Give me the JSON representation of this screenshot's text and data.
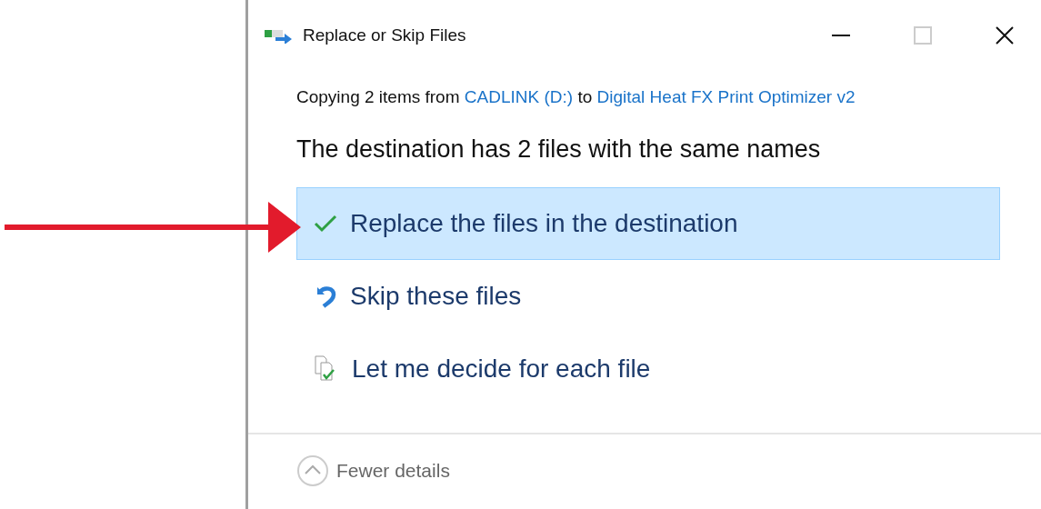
{
  "window": {
    "title": "Replace or Skip Files"
  },
  "copying": {
    "prefix": "Copying 2 items from",
    "source": "CADLINK (D:)",
    "joiner": "to",
    "destination": "Digital Heat FX Print Optimizer v2"
  },
  "heading": "The destination has 2 files with the same names",
  "options": [
    {
      "kind": "replace",
      "label": "Replace the files in the destination",
      "selected": true
    },
    {
      "kind": "skip",
      "label": "Skip these files",
      "selected": false
    },
    {
      "kind": "decide",
      "label": "Let me decide for each file",
      "selected": false
    }
  ],
  "details_toggle": {
    "label": "Fewer details",
    "expanded": true
  }
}
